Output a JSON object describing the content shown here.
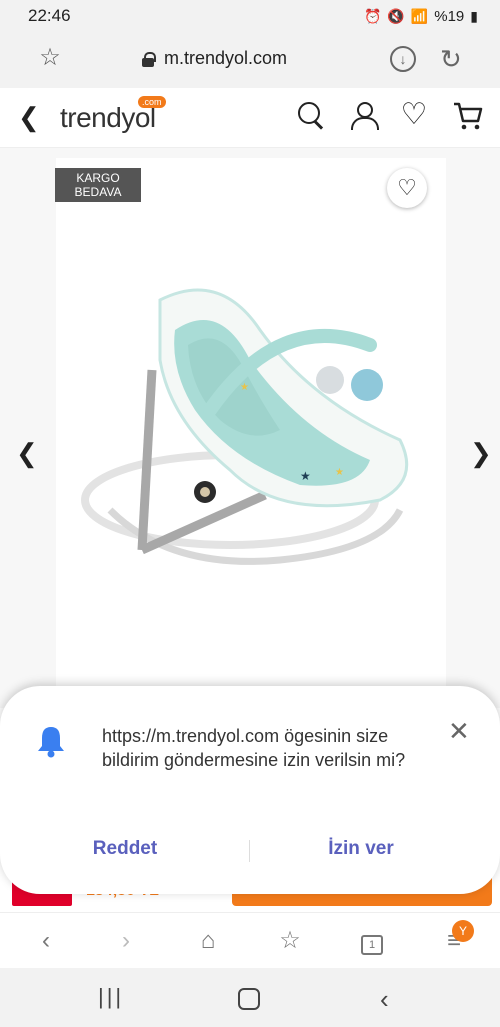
{
  "status_bar": {
    "time": "22:46",
    "battery": "%19"
  },
  "browser": {
    "url": "m.trendyol.com"
  },
  "site_header": {
    "logo_text": "trendyol",
    "logo_badge": ".com"
  },
  "product": {
    "badge_line1": "KARGO",
    "badge_line2": "BEDAVA",
    "price_partial": "134,50 TL"
  },
  "notification": {
    "message": "https://m.trendyol.com ögesinin size bildirim göndermesine izin verilsin mi?",
    "deny_label": "Reddet",
    "allow_label": "İzin ver"
  },
  "browser_toolbar": {
    "tabs_count": "1",
    "menu_badge": "Y"
  },
  "colors": {
    "brand_orange": "#f27a1a",
    "dialog_button": "#5a60bd",
    "bell_blue": "#3a7ff0"
  }
}
